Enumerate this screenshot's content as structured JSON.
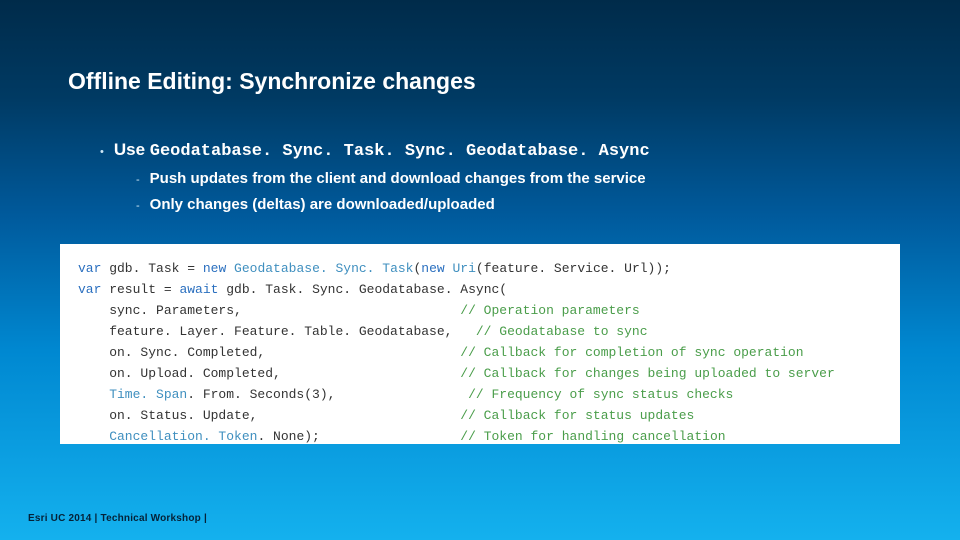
{
  "title": "Offline Editing: Synchronize changes",
  "bullet": {
    "prefix": "Use ",
    "code": "Geodatabase. Sync. Task. Sync. Geodatabase. Async"
  },
  "sub": {
    "a": "Push updates from the client and download changes from the service",
    "b": "Only changes (deltas) are downloaded/uploaded"
  },
  "code": {
    "l1": {
      "kw1": "var",
      "id1": " gdb. Task ",
      "op1": "= ",
      "kw2": "new",
      "typ1": " Geodatabase. Sync. Task",
      "pln1": "(",
      "kw3": "new",
      "typ2": " Uri",
      "pln2": "(feature. Service. Url));"
    },
    "l2": {
      "kw1": "var",
      "id1": " result ",
      "op1": "= ",
      "kw2": "await",
      "id2": " gdb. Task. Sync. Geodatabase. Async("
    },
    "l3": {
      "arg": "    sync. Parameters,",
      "pad": "                            ",
      "com": "// Operation parameters"
    },
    "l4": {
      "arg": "    feature. Layer. Feature. Table. Geodatabase,",
      "pad": "   ",
      "com": "// Geodatabase to sync"
    },
    "l5": {
      "arg": "    on. Sync. Completed,",
      "pad": "                         ",
      "com": "// Callback for completion of sync operation"
    },
    "l6": {
      "arg": "    on. Upload. Completed,",
      "pad": "                       ",
      "com": "// Callback for changes being uploaded to server"
    },
    "l7": {
      "typ": "    Time. Span",
      "arg": ". From. Seconds(3),",
      "pad": "                 ",
      "com": "// Frequency of sync status checks"
    },
    "l8": {
      "arg": "    on. Status. Update,",
      "pad": "                          ",
      "com": "// Callback for status updates"
    },
    "l9": {
      "typ": "    Cancellation. Token",
      "arg": ". None);",
      "pad": "                  ",
      "com": "// Token for handling cancellation"
    }
  },
  "footer": "Esri UC 2014 | Technical Workshop |"
}
